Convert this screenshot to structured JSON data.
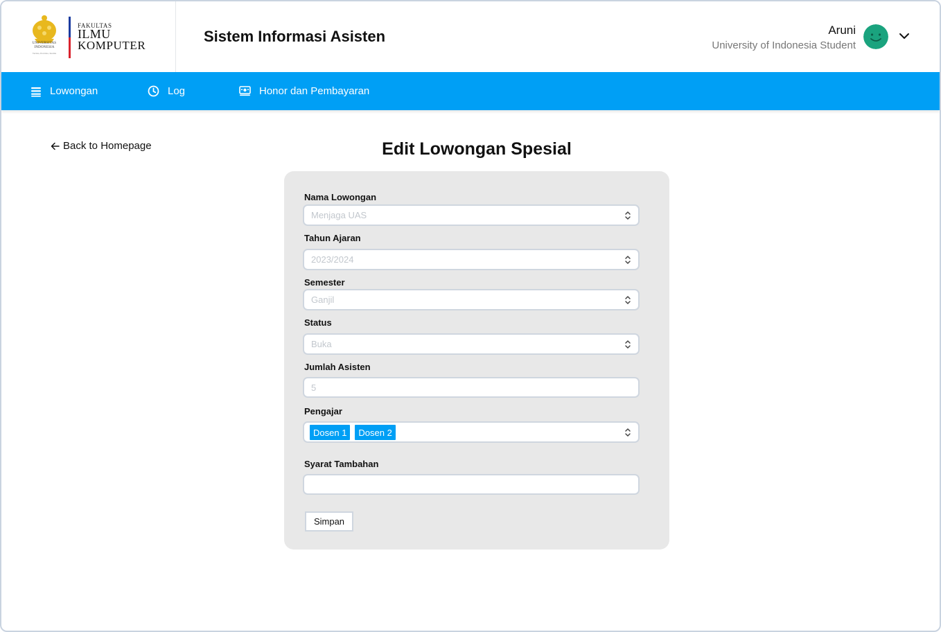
{
  "brand": {
    "emblem_caption": "UNIVERSITAS INDONESIA",
    "emblem_motto": "Veritas, Probitas, Iustitia",
    "faculty_small": "FAKULTAS",
    "faculty_line1": "ILMU",
    "faculty_line2": "KOMPUTER",
    "emblem_color": "#e8b81e"
  },
  "header": {
    "app_title": "Sistem Informasi Asisten",
    "user_name": "Aruni",
    "user_role": "University of Indonesia Student",
    "avatar_color": "#1aa37e"
  },
  "nav": {
    "color": "#009ff5",
    "items": [
      {
        "label": "Lowongan",
        "icon": "list-icon"
      },
      {
        "label": "Log",
        "icon": "clock-icon"
      },
      {
        "label": "Honor dan Pembayaran",
        "icon": "payment-icon"
      }
    ]
  },
  "page": {
    "back_label": "Back to Homepage",
    "title": "Edit Lowongan Spesial"
  },
  "form": {
    "fields": [
      {
        "label": "Nama Lowongan",
        "value": "Menjaga UAS",
        "type": "select"
      },
      {
        "label": "Tahun Ajaran",
        "value": "2023/2024",
        "type": "select"
      },
      {
        "label": "Semester",
        "value": "Ganjil",
        "type": "select"
      },
      {
        "label": "Status",
        "value": "Buka",
        "type": "select"
      },
      {
        "label": "Jumlah Asisten",
        "value": "5",
        "type": "input"
      },
      {
        "label": "Pengajar",
        "values": [
          "Dosen 1",
          "Dosen 2"
        ],
        "type": "multiselect"
      },
      {
        "label": "Syarat Tambahan",
        "value": "",
        "type": "input"
      }
    ],
    "submit_label": "Simpan"
  }
}
